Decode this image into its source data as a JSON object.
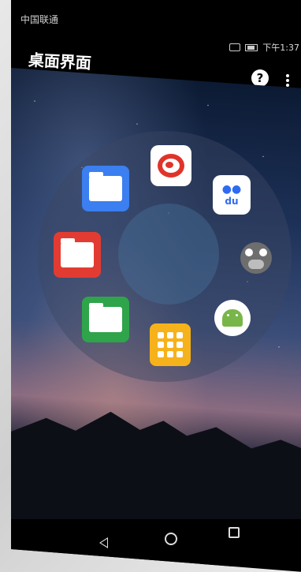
{
  "status": {
    "carrier": "中国联通",
    "time": "下午1:37"
  },
  "toolbar": {
    "title": "桌面界面",
    "help_label": "?"
  },
  "apps": [
    {
      "name": "folder-blue",
      "icon": "folder-icon"
    },
    {
      "name": "weibo",
      "icon": "weibo-icon"
    },
    {
      "name": "baidu",
      "icon": "baidu-icon",
      "text": "du"
    },
    {
      "name": "folder-red",
      "icon": "folder-icon"
    },
    {
      "name": "monkey",
      "icon": "monkey-icon"
    },
    {
      "name": "folder-green",
      "icon": "folder-icon"
    },
    {
      "name": "android",
      "icon": "android-icon"
    },
    {
      "name": "grid",
      "icon": "app-grid-icon"
    }
  ],
  "colors": {
    "folder_blue": "#3b7ff0",
    "folder_red": "#e23c32",
    "folder_green": "#2fa44b",
    "grid_yellow": "#f6b21b"
  },
  "navbar": {
    "back": "back-icon",
    "home": "home-icon",
    "recent": "recent-apps-icon"
  }
}
